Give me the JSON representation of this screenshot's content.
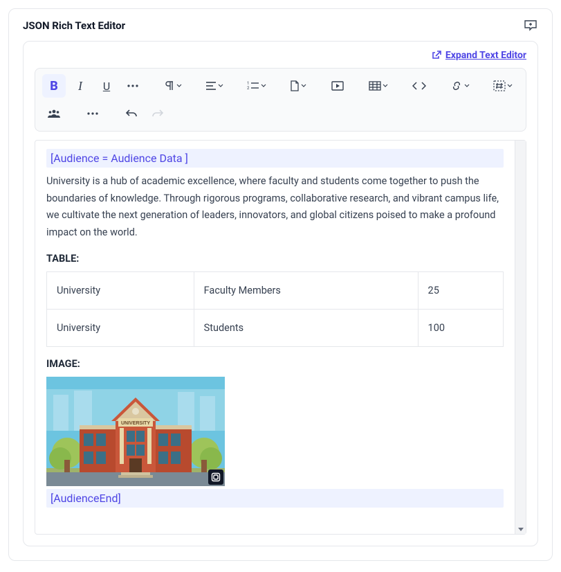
{
  "header": {
    "title": "JSON Rich Text Editor",
    "expand_label": "Expand Text Editor"
  },
  "toolbar": {
    "bold": "B",
    "italic": "I",
    "underline": "U"
  },
  "content": {
    "audience_open": "[Audience = Audience Data ]",
    "body_text": "University is a hub of academic excellence, where faculty and students come together to push the boundaries of knowledge. Through rigorous programs, collaborative research, and vibrant campus life, we cultivate the next generation of leaders, innovators, and global citizens poised to make a profound impact on the world.",
    "table_label": "TABLE:",
    "image_label": "IMAGE:",
    "audience_close": "[AudienceEnd]",
    "table": {
      "rows": [
        {
          "c0": "University",
          "c1": "Faculty Members",
          "c2": "25"
        },
        {
          "c0": "University",
          "c1": "Students",
          "c2": "100"
        }
      ]
    },
    "image": {
      "caption": "UNIVERSITY"
    }
  }
}
